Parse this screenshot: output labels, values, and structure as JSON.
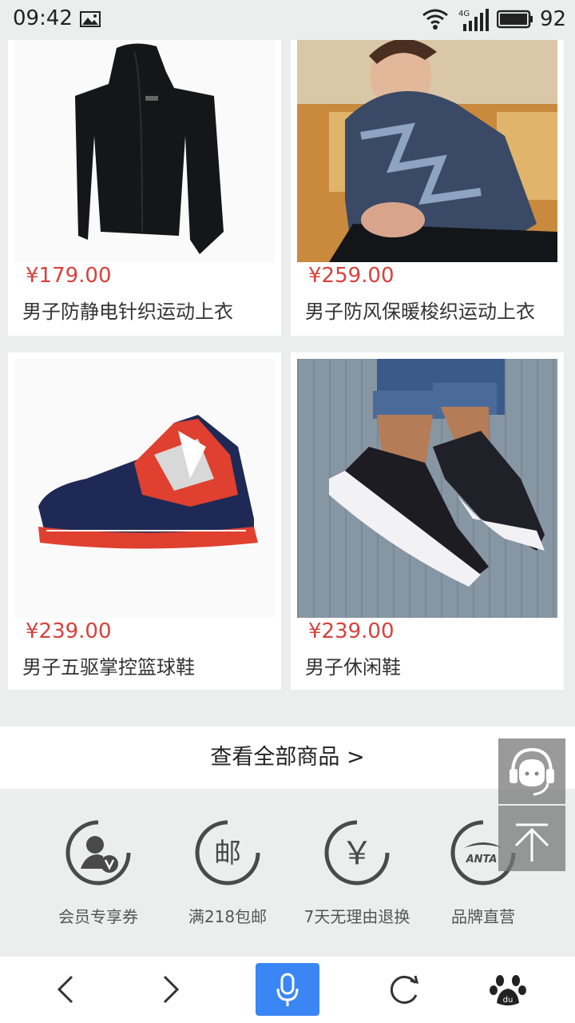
{
  "status_bar": {
    "time": "09:42",
    "network": "4G",
    "battery": "92"
  },
  "products": [
    {
      "price": "¥179.00",
      "name": "男子防静电针织运动上衣",
      "image": "black zip hoodie jacket"
    },
    {
      "price": "¥259.00",
      "name": "男子防风保暖梭织运动上衣",
      "image": "man in camo hooded jacket"
    },
    {
      "price": "¥239.00",
      "name": "男子五驱掌控篮球鞋",
      "image": "navy red camo basketball shoe"
    },
    {
      "price": "¥239.00",
      "name": "男子休闲鞋",
      "image": "black knit sneakers on feet"
    }
  ],
  "view_all": "查看全部商品 >",
  "benefits": [
    {
      "label": "会员专享券",
      "icon": "member-icon"
    },
    {
      "label": "满218包邮",
      "icon": "mail-icon",
      "glyph": "邮"
    },
    {
      "label": "7天无理由退换",
      "icon": "yen-icon",
      "glyph": "￥"
    },
    {
      "label": "品牌直营",
      "icon": "anta-logo-icon",
      "glyph": "ANTA"
    }
  ],
  "floating": {
    "service_icon": "customer-service-icon",
    "top_icon": "back-to-top-icon"
  },
  "bottom_nav": {
    "back": "back-icon",
    "forward": "forward-icon",
    "voice": "microphone-icon",
    "refresh": "refresh-icon",
    "home": "baidu-paw-icon"
  },
  "colors": {
    "price": "#d8413d",
    "mic_bg": "#3b86f5",
    "page_bg": "#eceeee"
  }
}
